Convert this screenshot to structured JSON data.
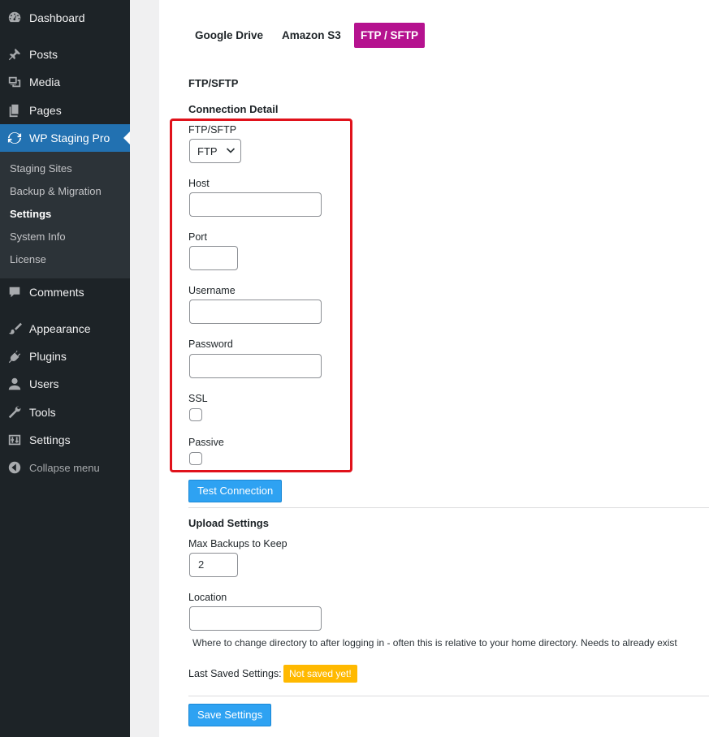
{
  "sidebar": {
    "dashboard": "Dashboard",
    "posts": "Posts",
    "media": "Media",
    "pages": "Pages",
    "wp_staging": "WP Staging Pro",
    "submenu": [
      "Staging Sites",
      "Backup & Migration",
      "Settings",
      "System Info",
      "License"
    ],
    "comments": "Comments",
    "appearance": "Appearance",
    "plugins": "Plugins",
    "users": "Users",
    "tools": "Tools",
    "settings": "Settings",
    "collapse": "Collapse menu"
  },
  "tabs": [
    "Google Drive",
    "Amazon S3",
    "FTP / SFTP"
  ],
  "section": {
    "title": "FTP/SFTP",
    "connection_detail": "Connection Detail",
    "upload_settings": "Upload Settings"
  },
  "fields": {
    "ftp_type": {
      "label": "FTP/SFTP",
      "value": "FTP"
    },
    "host": {
      "label": "Host",
      "value": ""
    },
    "port": {
      "label": "Port",
      "value": ""
    },
    "username": {
      "label": "Username",
      "value": ""
    },
    "password": {
      "label": "Password",
      "value": ""
    },
    "ssl": {
      "label": "SSL"
    },
    "passive": {
      "label": "Passive"
    },
    "max_backups": {
      "label": "Max Backups to Keep",
      "value": "2"
    },
    "location": {
      "label": "Location",
      "value": ""
    }
  },
  "buttons": {
    "test_connection": "Test Connection",
    "save_settings": "Save Settings"
  },
  "location_help": "Where to change directory to after logging in - often this is relative to your home directory. Needs to already exist",
  "last_saved": {
    "label": "Last Saved Settings:",
    "badge": "Not saved yet!"
  },
  "colors": {
    "sidebar_bg": "#1d2327",
    "active_menu": "#2271b1",
    "active_tab": "#b5128f",
    "button": "#2ea2f2",
    "highlight": "#e0121b",
    "badge": "#ffb900"
  }
}
